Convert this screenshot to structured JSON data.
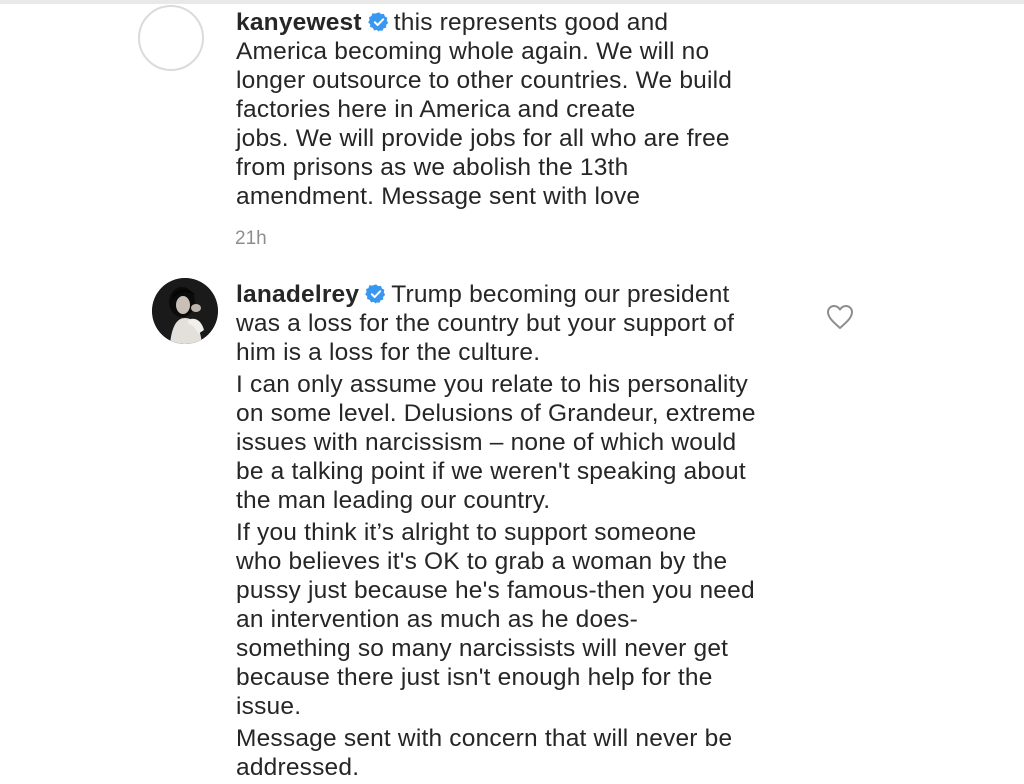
{
  "comments": [
    {
      "username": "kanyewest",
      "verified_icon": "verified-badge-icon",
      "lines": [
        "this represents good and",
        "America becoming whole again.  We will no",
        "longer outsource to other countries. We build",
        "factories here in America and create",
        "jobs.  We will provide jobs for all who are free",
        "from prisons as we abolish the 13th",
        "amendment. Message sent with love"
      ],
      "timestamp": "21h",
      "avatar_icon": "avatar-placeholder"
    },
    {
      "username": "lanadelrey",
      "verified_icon": "verified-badge-icon",
      "avatar_icon": "avatar-photo",
      "like_icon": "heart-outline-icon",
      "paragraphs": [
        [
          "Trump becoming our president",
          "was a loss for the country but your support of",
          "him is a loss for the culture."
        ],
        [
          "I can only assume you relate to his personality",
          "on some level. Delusions of Grandeur, extreme",
          "issues with narcissism – none of which would",
          "be a talking point if we weren't speaking about",
          "the man leading our country."
        ],
        [
          "If you think it’s alright to support someone",
          "who believes it's OK to grab a woman by the",
          "pussy just because he's famous-then you need",
          "an intervention as much as he does-",
          "something so many narcissists will never get",
          "because there just isn't enough help for the",
          "issue."
        ],
        [
          "Message sent with concern that will never be",
          "addressed."
        ]
      ]
    }
  ],
  "colors": {
    "text": "#262626",
    "muted": "#8e8e8e",
    "verified": "#3897f0",
    "border": "#dbdbdb"
  }
}
